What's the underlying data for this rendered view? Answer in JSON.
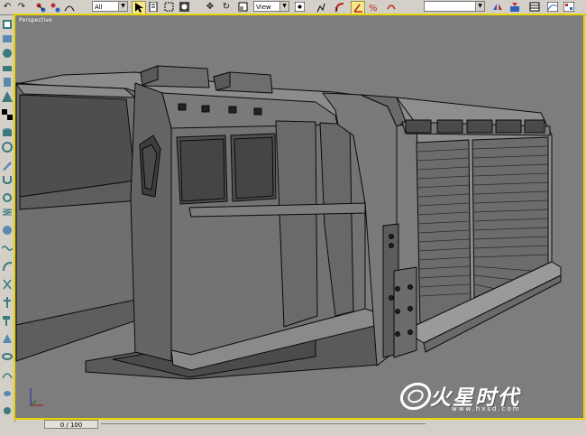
{
  "toolbar": {
    "selection_filter": "All",
    "reference_coord": "View",
    "buttons": [
      "undo-icon",
      "redo-icon",
      "select-link-icon",
      "unlink-icon",
      "bind-spacewarp-icon",
      "select-object-icon",
      "select-by-name-icon",
      "rect-region-icon",
      "window-crossing-icon",
      "move-icon",
      "rotate-icon",
      "scale-icon",
      "pivot-icon",
      "select-manipulate-icon",
      "snap-3d-icon",
      "angle-snap-icon",
      "percent-snap-icon",
      "spinner-snap-icon",
      "named-selection-sets",
      "mirror-icon",
      "align-icon",
      "layer-manager-icon"
    ]
  },
  "viewport": {
    "label": "Perspective",
    "background": "#7d7d7d",
    "border_color": "#e8d400"
  },
  "timebar": {
    "frame_counter": "0 / 100"
  },
  "watermark": {
    "brand": "火星时代",
    "url": "www.hxsd.com"
  }
}
